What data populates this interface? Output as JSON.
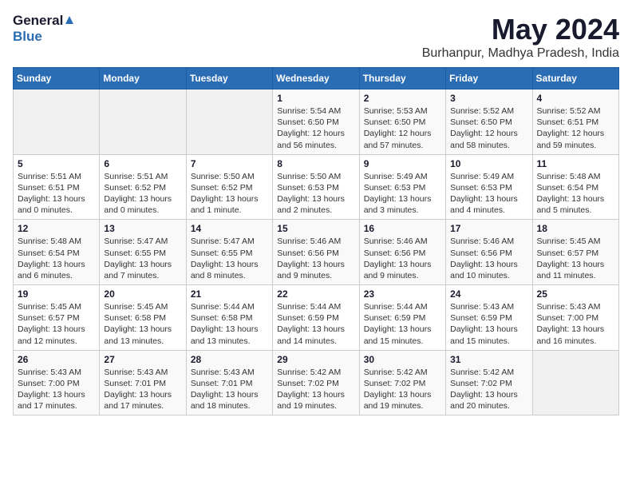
{
  "logo": {
    "general": "General",
    "blue": "Blue"
  },
  "title": "May 2024",
  "subtitle": "Burhanpur, Madhya Pradesh, India",
  "days_of_week": [
    "Sunday",
    "Monday",
    "Tuesday",
    "Wednesday",
    "Thursday",
    "Friday",
    "Saturday"
  ],
  "weeks": [
    [
      {
        "day": "",
        "info": ""
      },
      {
        "day": "",
        "info": ""
      },
      {
        "day": "",
        "info": ""
      },
      {
        "day": "1",
        "info": "Sunrise: 5:54 AM\nSunset: 6:50 PM\nDaylight: 12 hours\nand 56 minutes."
      },
      {
        "day": "2",
        "info": "Sunrise: 5:53 AM\nSunset: 6:50 PM\nDaylight: 12 hours\nand 57 minutes."
      },
      {
        "day": "3",
        "info": "Sunrise: 5:52 AM\nSunset: 6:50 PM\nDaylight: 12 hours\nand 58 minutes."
      },
      {
        "day": "4",
        "info": "Sunrise: 5:52 AM\nSunset: 6:51 PM\nDaylight: 12 hours\nand 59 minutes."
      }
    ],
    [
      {
        "day": "5",
        "info": "Sunrise: 5:51 AM\nSunset: 6:51 PM\nDaylight: 13 hours\nand 0 minutes."
      },
      {
        "day": "6",
        "info": "Sunrise: 5:51 AM\nSunset: 6:52 PM\nDaylight: 13 hours\nand 0 minutes."
      },
      {
        "day": "7",
        "info": "Sunrise: 5:50 AM\nSunset: 6:52 PM\nDaylight: 13 hours\nand 1 minute."
      },
      {
        "day": "8",
        "info": "Sunrise: 5:50 AM\nSunset: 6:53 PM\nDaylight: 13 hours\nand 2 minutes."
      },
      {
        "day": "9",
        "info": "Sunrise: 5:49 AM\nSunset: 6:53 PM\nDaylight: 13 hours\nand 3 minutes."
      },
      {
        "day": "10",
        "info": "Sunrise: 5:49 AM\nSunset: 6:53 PM\nDaylight: 13 hours\nand 4 minutes."
      },
      {
        "day": "11",
        "info": "Sunrise: 5:48 AM\nSunset: 6:54 PM\nDaylight: 13 hours\nand 5 minutes."
      }
    ],
    [
      {
        "day": "12",
        "info": "Sunrise: 5:48 AM\nSunset: 6:54 PM\nDaylight: 13 hours\nand 6 minutes."
      },
      {
        "day": "13",
        "info": "Sunrise: 5:47 AM\nSunset: 6:55 PM\nDaylight: 13 hours\nand 7 minutes."
      },
      {
        "day": "14",
        "info": "Sunrise: 5:47 AM\nSunset: 6:55 PM\nDaylight: 13 hours\nand 8 minutes."
      },
      {
        "day": "15",
        "info": "Sunrise: 5:46 AM\nSunset: 6:56 PM\nDaylight: 13 hours\nand 9 minutes."
      },
      {
        "day": "16",
        "info": "Sunrise: 5:46 AM\nSunset: 6:56 PM\nDaylight: 13 hours\nand 9 minutes."
      },
      {
        "day": "17",
        "info": "Sunrise: 5:46 AM\nSunset: 6:56 PM\nDaylight: 13 hours\nand 10 minutes."
      },
      {
        "day": "18",
        "info": "Sunrise: 5:45 AM\nSunset: 6:57 PM\nDaylight: 13 hours\nand 11 minutes."
      }
    ],
    [
      {
        "day": "19",
        "info": "Sunrise: 5:45 AM\nSunset: 6:57 PM\nDaylight: 13 hours\nand 12 minutes."
      },
      {
        "day": "20",
        "info": "Sunrise: 5:45 AM\nSunset: 6:58 PM\nDaylight: 13 hours\nand 13 minutes."
      },
      {
        "day": "21",
        "info": "Sunrise: 5:44 AM\nSunset: 6:58 PM\nDaylight: 13 hours\nand 13 minutes."
      },
      {
        "day": "22",
        "info": "Sunrise: 5:44 AM\nSunset: 6:59 PM\nDaylight: 13 hours\nand 14 minutes."
      },
      {
        "day": "23",
        "info": "Sunrise: 5:44 AM\nSunset: 6:59 PM\nDaylight: 13 hours\nand 15 minutes."
      },
      {
        "day": "24",
        "info": "Sunrise: 5:43 AM\nSunset: 6:59 PM\nDaylight: 13 hours\nand 15 minutes."
      },
      {
        "day": "25",
        "info": "Sunrise: 5:43 AM\nSunset: 7:00 PM\nDaylight: 13 hours\nand 16 minutes."
      }
    ],
    [
      {
        "day": "26",
        "info": "Sunrise: 5:43 AM\nSunset: 7:00 PM\nDaylight: 13 hours\nand 17 minutes."
      },
      {
        "day": "27",
        "info": "Sunrise: 5:43 AM\nSunset: 7:01 PM\nDaylight: 13 hours\nand 17 minutes."
      },
      {
        "day": "28",
        "info": "Sunrise: 5:43 AM\nSunset: 7:01 PM\nDaylight: 13 hours\nand 18 minutes."
      },
      {
        "day": "29",
        "info": "Sunrise: 5:42 AM\nSunset: 7:02 PM\nDaylight: 13 hours\nand 19 minutes."
      },
      {
        "day": "30",
        "info": "Sunrise: 5:42 AM\nSunset: 7:02 PM\nDaylight: 13 hours\nand 19 minutes."
      },
      {
        "day": "31",
        "info": "Sunrise: 5:42 AM\nSunset: 7:02 PM\nDaylight: 13 hours\nand 20 minutes."
      },
      {
        "day": "",
        "info": ""
      }
    ]
  ]
}
